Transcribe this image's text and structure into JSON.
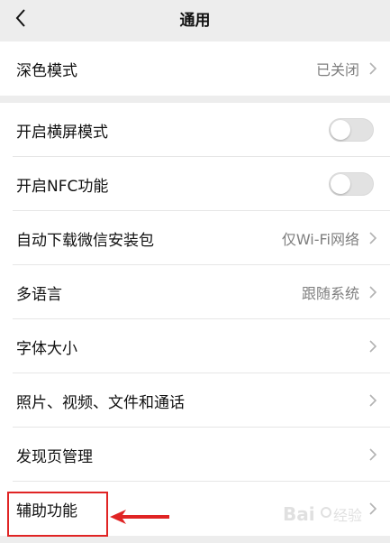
{
  "header": {
    "title": "通用",
    "back_icon": "chevron-left-icon"
  },
  "dark_mode": {
    "label": "深色模式",
    "value": "已关闭"
  },
  "settings": {
    "landscape": {
      "label": "开启横屏模式",
      "enabled": false
    },
    "nfc": {
      "label": "开启NFC功能",
      "enabled": false
    },
    "auto_download": {
      "label": "自动下载微信安装包",
      "value": "仅Wi-Fi网络"
    },
    "language": {
      "label": "多语言",
      "value": "跟随系统"
    },
    "font_size": {
      "label": "字体大小"
    },
    "media": {
      "label": "照片、视频、文件和通话"
    },
    "discover": {
      "label": "发现页管理"
    },
    "accessibility": {
      "label": "辅助功能"
    }
  },
  "annotation": {
    "highlight_color": "#e02424"
  },
  "colors": {
    "background": "#ededed",
    "card": "#ffffff",
    "secondary_text": "#7f7f7f"
  }
}
